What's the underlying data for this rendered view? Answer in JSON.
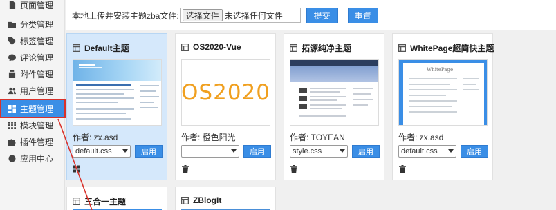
{
  "sidebar": {
    "items": [
      {
        "label": "页面管理",
        "icon": "file-icon"
      },
      {
        "label": "分类管理",
        "icon": "folder-icon"
      },
      {
        "label": "标签管理",
        "icon": "tag-icon"
      },
      {
        "label": "评论管理",
        "icon": "comment-icon"
      },
      {
        "label": "附件管理",
        "icon": "attachment-icon"
      },
      {
        "label": "用户管理",
        "icon": "users-icon"
      },
      {
        "label": "主题管理",
        "icon": "theme-icon",
        "active": true
      },
      {
        "label": "模块管理",
        "icon": "grid-icon"
      },
      {
        "label": "插件管理",
        "icon": "puzzle-icon"
      },
      {
        "label": "应用中心",
        "icon": "app-center-icon"
      }
    ]
  },
  "upload": {
    "label": "本地上传并安装主题zba文件:",
    "file_button": "选择文件",
    "file_status": "未选择任何文件",
    "submit": "提交",
    "reset": "重置"
  },
  "themes": [
    {
      "title": "Default主题",
      "author": "作者: zx.asd",
      "style": "default.css",
      "apply": "启用",
      "action_icon": "grid-icon",
      "selected": true
    },
    {
      "title": "OS2020-Vue",
      "author": "作者: 橙色阳光",
      "style": "",
      "apply": "启用",
      "action_icon": "trash-icon",
      "thumb_text": "OS2020"
    },
    {
      "title": "拓源纯净主题",
      "author": "作者: TOYEAN",
      "style": "style.css",
      "apply": "启用",
      "action_icon": "trash-icon"
    },
    {
      "title": "WhitePage超简快主题",
      "author": "作者: zx.asd",
      "style": "default.css",
      "apply": "启用",
      "action_icon": "trash-icon",
      "thumb_text": "WhitePage"
    },
    {
      "title": "三合一主题"
    },
    {
      "title": "ZBlogIt"
    }
  ],
  "colors": {
    "accent": "#3a8ee6",
    "highlight": "#d9322b",
    "selected_card": "#d5e8fb"
  }
}
